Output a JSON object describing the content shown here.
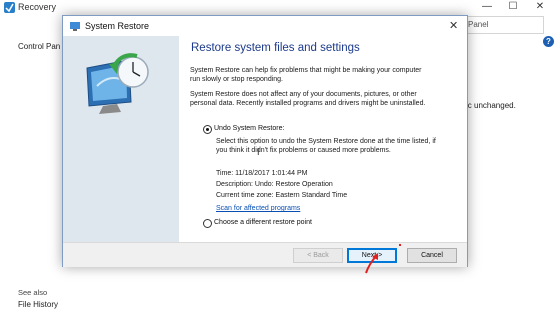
{
  "background": {
    "title": "Recovery",
    "search_placeholder": "Panel",
    "breadcrumb": "Control Pan",
    "right_text": "ic unchanged.",
    "see_also": "See also",
    "file_history": "File History",
    "controls": {
      "minimize": "—",
      "maximize": "☐",
      "close": "✕"
    },
    "help": "?"
  },
  "dialog": {
    "title": "System Restore",
    "close": "✕",
    "heading": "Restore system files and settings",
    "paragraph1": "System Restore can help fix problems that might be making your computer run slowly or stop responding.",
    "paragraph2": "System Restore does not affect any of your documents, pictures, or other personal data. Recently installed programs and drivers might be uninstalled.",
    "options": [
      {
        "label": "Undo System Restore:",
        "selected": true
      },
      {
        "label": "Choose a different restore point",
        "selected": false
      }
    ],
    "undo_description": "Select this option to undo the System Restore done at the time listed, if you think it didn't fix problems or caused more problems.",
    "time": "Time: 11/18/2017 1:01:44 PM",
    "description": "Description: Undo: Restore Operation",
    "timezone": "Current time zone: Eastern Standard Time",
    "scan_link": "Scan for affected programs",
    "buttons": {
      "back": "< Back",
      "next": "Next >",
      "cancel": "Cancel"
    }
  },
  "colors": {
    "heading": "#1c3a8a",
    "link": "#0a4fb4",
    "accent": "#0078d7",
    "annotation": "#e02020"
  },
  "icons": [
    "recovery-app-icon",
    "system-restore-icon",
    "help-icon",
    "cursor-icon",
    "annotation-arrow-icon"
  ]
}
